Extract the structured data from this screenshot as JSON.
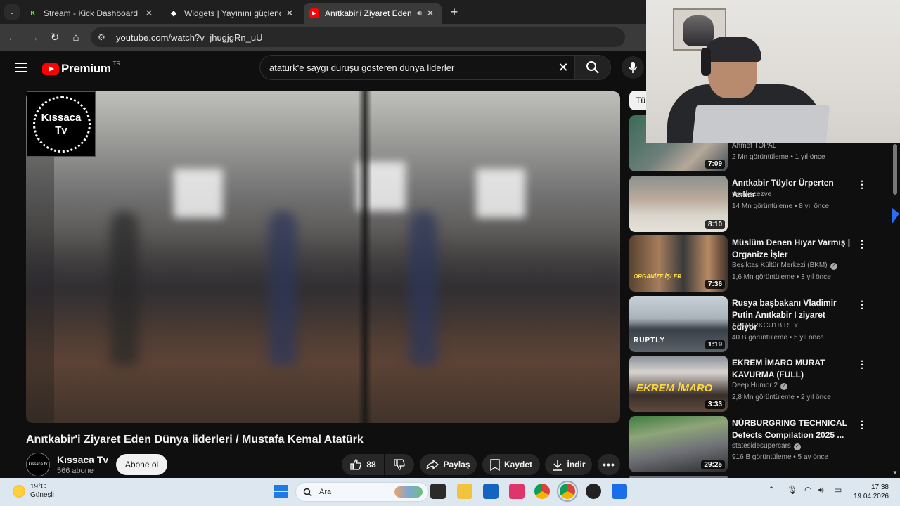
{
  "tabs": [
    {
      "title": "Stream - Kick Dashboard",
      "favicon_color": "#53fc18",
      "favicon_glyph": "K",
      "active": false
    },
    {
      "title": "Widgets | Yayınını güçlendirmek",
      "favicon_color": "#ffffff",
      "favicon_glyph": "◆",
      "active": false
    },
    {
      "title": "Anıtkabir'i Ziyaret Eden Dünya",
      "favicon_color": "#ff0000",
      "favicon_glyph": "▶",
      "active": true
    }
  ],
  "address": {
    "url": "youtube.com/watch?v=jhugjgRn_uU"
  },
  "header": {
    "brand": "Premium",
    "country": "TR",
    "search_query": "atatürk'e saygı duruşu gösteren dünya liderler"
  },
  "player": {
    "channel_logo_text_1": "Kıssaca",
    "channel_logo_text_2": "Tv"
  },
  "video": {
    "title": "Anıtkabir'i Ziyaret Eden Dünya liderleri / Mustafa Kemal Atatürk",
    "channel": "Kıssaca Tv",
    "subscribers": "566 abone",
    "avatar_text": "kıssaca tv",
    "subscribe_label": "Abone ol",
    "likes": "88",
    "share_label": "Paylaş",
    "save_label": "Kaydet",
    "download_label": "İndir"
  },
  "sidebar": {
    "chip": "Tü",
    "items": [
      {
        "title": "",
        "channel": "Ahmet TOPAL",
        "meta": "2 Mn görüntüleme • 1 yıl önce",
        "duration": "7:09",
        "verified": false
      },
      {
        "title": "Anıtkabir Tüyler Ürperten Asker",
        "channel": "tenekecezve",
        "meta": "14 Mn görüntüleme • 8 yıl önce",
        "duration": "8:10",
        "verified": false
      },
      {
        "title": "Müslüm Denen Hıyar Varmış | Organize İşler",
        "channel": "Beşiktaş Kültür Merkezi (BKM)",
        "meta": "1,6 Mn görüntüleme • 3 yıl önce",
        "duration": "7:36",
        "verified": true,
        "thumb_text": "ORGANİZE İŞLER"
      },
      {
        "title": "Rusya başbakanı Vladimir Putin Anıtkabir I ziyaret ediyor",
        "channel": "ATATURKCU1BIREY",
        "meta": "40 B görüntüleme • 5 yıl önce",
        "duration": "1:19",
        "verified": false,
        "thumb_text": "RUPTLY"
      },
      {
        "title": "EKREM İMARO MURAT KAVURMA (FULL)",
        "channel": "Deep Humor 2",
        "meta": "2,8 Mn görüntüleme • 2 yıl önce",
        "duration": "3:33",
        "verified": true,
        "thumb_text": "EKREM İMARO"
      },
      {
        "title": "NÜRBURGRING TECHNICAL Defects Compilation 2025 ...",
        "channel": "statesidesupercars",
        "meta": "916 B görüntüleme • 5 ay önce",
        "duration": "29:25",
        "verified": true
      }
    ]
  },
  "taskbar": {
    "weather_temp": "19°C",
    "weather_desc": "Güneşli",
    "search_placeholder": "Ara",
    "time": "17:38",
    "date": "19.04.2026"
  },
  "icons": {
    "search": "search-icon",
    "mic": "mic-icon",
    "like": "thumbs-up-icon",
    "dislike": "thumbs-down-icon",
    "share": "share-icon",
    "save": "bookmark-icon",
    "download": "download-icon",
    "more": "more-horizontal-icon"
  }
}
